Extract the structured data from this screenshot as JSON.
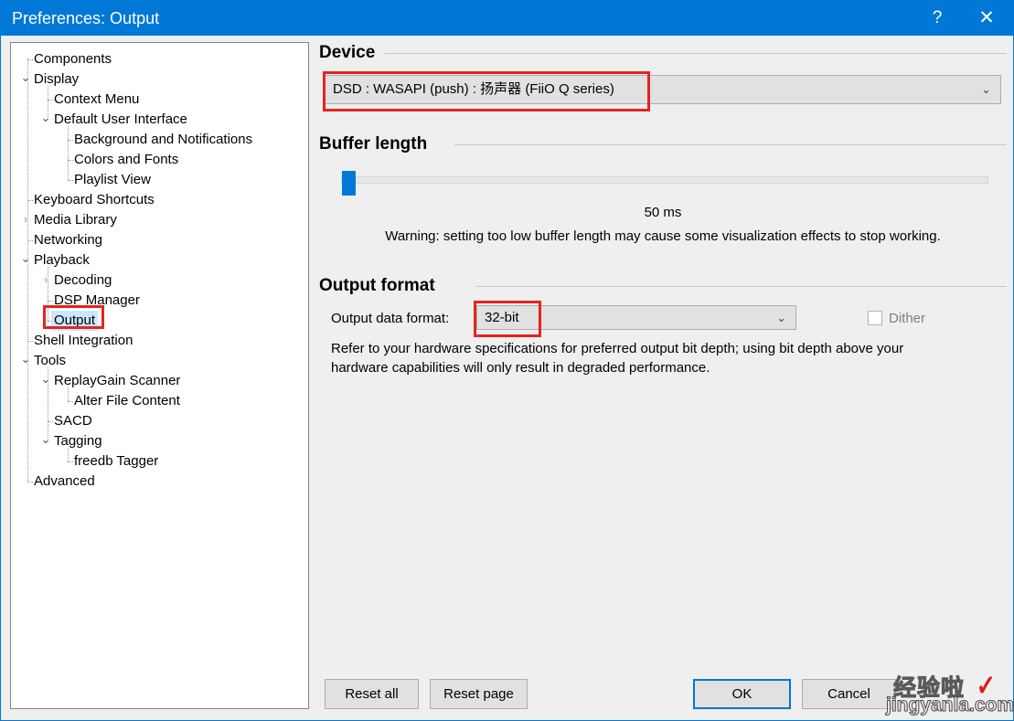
{
  "window": {
    "title": "Preferences: Output",
    "titlebar_color": "#0078d7",
    "help_icon": "?",
    "close_icon": "✕"
  },
  "tree": {
    "selected": "Output",
    "items": [
      {
        "label": "Components",
        "depth": 1,
        "toggle": "none"
      },
      {
        "label": "Display",
        "depth": 1,
        "toggle": "expanded"
      },
      {
        "label": "Context Menu",
        "depth": 2,
        "toggle": "none"
      },
      {
        "label": "Default User Interface",
        "depth": 2,
        "toggle": "expanded"
      },
      {
        "label": "Background and Notifications",
        "depth": 3,
        "toggle": "none"
      },
      {
        "label": "Colors and Fonts",
        "depth": 3,
        "toggle": "none"
      },
      {
        "label": "Playlist View",
        "depth": 3,
        "toggle": "none"
      },
      {
        "label": "Keyboard Shortcuts",
        "depth": 1,
        "toggle": "none"
      },
      {
        "label": "Media Library",
        "depth": 1,
        "toggle": "collapsed"
      },
      {
        "label": "Networking",
        "depth": 1,
        "toggle": "none"
      },
      {
        "label": "Playback",
        "depth": 1,
        "toggle": "expanded"
      },
      {
        "label": "Decoding",
        "depth": 2,
        "toggle": "collapsed"
      },
      {
        "label": "DSP Manager",
        "depth": 2,
        "toggle": "none"
      },
      {
        "label": "Output",
        "depth": 2,
        "toggle": "none"
      },
      {
        "label": "Shell Integration",
        "depth": 1,
        "toggle": "none"
      },
      {
        "label": "Tools",
        "depth": 1,
        "toggle": "expanded"
      },
      {
        "label": "ReplayGain Scanner",
        "depth": 2,
        "toggle": "expanded"
      },
      {
        "label": "Alter File Content",
        "depth": 3,
        "toggle": "none"
      },
      {
        "label": "SACD",
        "depth": 2,
        "toggle": "none"
      },
      {
        "label": "Tagging",
        "depth": 2,
        "toggle": "expanded"
      },
      {
        "label": "freedb Tagger",
        "depth": 3,
        "toggle": "none"
      },
      {
        "label": "Advanced",
        "depth": 1,
        "toggle": "none"
      }
    ]
  },
  "device": {
    "group_title": "Device",
    "selected": "DSD : WASAPI (push) : 扬声器 (FiiO Q series)",
    "arrow_icon": "⌄"
  },
  "buffer": {
    "group_title": "Buffer length",
    "value_label": "50 ms",
    "warning": "Warning: setting too low buffer length may cause some visualization effects to stop working."
  },
  "output_format": {
    "group_title": "Output format",
    "data_format_label": "Output data format:",
    "data_format_value": "32-bit",
    "arrow_icon": "⌄",
    "dither_label": "Dither",
    "dither_checked": false,
    "description": "Refer to your hardware specifications for preferred output bit depth; using bit depth above your hardware capabilities will only result in degraded performance."
  },
  "footer": {
    "reset_all": "Reset all",
    "reset_page": "Reset page",
    "ok": "OK",
    "cancel": "Cancel"
  },
  "watermark": {
    "cn_text": "经验啦",
    "check_icon": "✓",
    "url": "jingyanla.com"
  },
  "annotations": {
    "accent_color": "#e8221f",
    "targets": [
      "device-combobox",
      "tree-item-output",
      "output-data-format-value"
    ]
  }
}
